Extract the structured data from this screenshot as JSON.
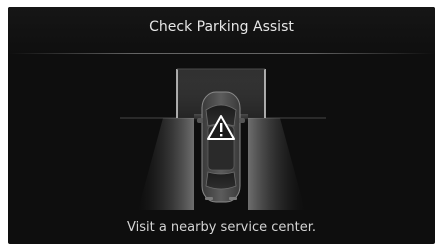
{
  "alert": {
    "title": "Check Parking Assist",
    "message": "Visit a nearby service center.",
    "icon": "warning-triangle-icon"
  },
  "colors": {
    "background": "#0e0e0e",
    "text": "#e6e6e6",
    "warning_icon": "#ffffff"
  }
}
